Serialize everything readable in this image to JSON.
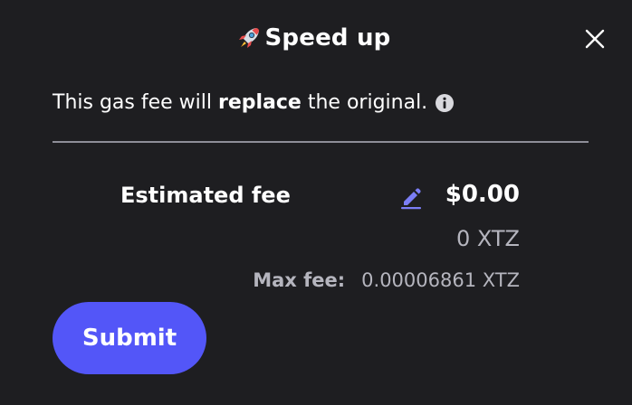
{
  "header": {
    "title": "Speed up",
    "title_icon": "rocket-icon",
    "close_icon": "close-icon"
  },
  "notice": {
    "prefix": "This gas fee will ",
    "emphasis": "replace",
    "suffix": " the original.",
    "info_icon": "info-icon"
  },
  "fee": {
    "label": "Estimated fee",
    "edit_icon": "pencil-icon",
    "usd_value": "$0.00",
    "xtz_value": "0 XTZ",
    "max_label": "Max fee:",
    "max_value": "0.00006861 XTZ"
  },
  "actions": {
    "submit_label": "Submit"
  },
  "colors": {
    "background": "#1e1e21",
    "accent": "#5356f8",
    "muted_text": "#b5b5be",
    "divider": "#8e8e98",
    "edit_icon": "#7b7ef6"
  }
}
